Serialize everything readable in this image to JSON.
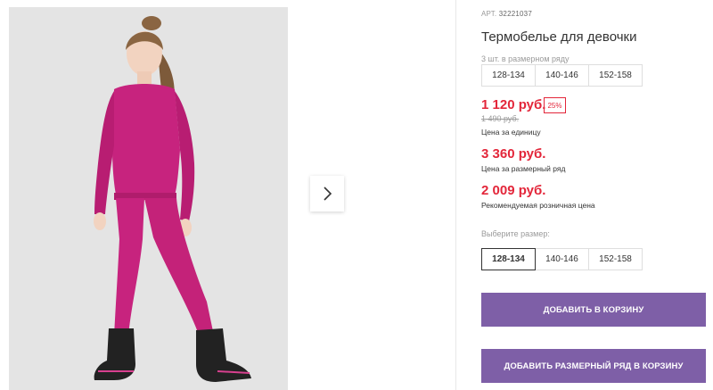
{
  "product": {
    "article_label": "АРТ.",
    "article_code": "32221037",
    "title": "Термобелье для девочки",
    "size_row_label": "3 шт. в размерном ряду",
    "size_row": [
      "128-134",
      "140-146",
      "152-158"
    ],
    "price_unit": "1 120 руб.",
    "discount_badge": "25%",
    "old_price": "1 490 руб.",
    "price_unit_note": "Цена за единицу",
    "price_row": "3 360 руб.",
    "price_row_note": "Цена за размерный ряд",
    "price_retail": "2 009 руб.",
    "price_retail_note": "Рекомендуемая розничная цена",
    "choose_size_label": "Выберите размер:",
    "sizes": [
      "128-134",
      "140-146",
      "152-158"
    ],
    "selected_size": "128-134",
    "add_to_cart_label": "ДОБАВИТЬ В КОРЗИНУ",
    "add_row_to_cart_label": "ДОБАВИТЬ РАЗМЕРНЫЙ РЯД В КОРЗИНУ"
  },
  "gallery": {
    "next_icon": "chevron-right-icon"
  },
  "colors": {
    "accent": "#7e5fa7",
    "price": "#e3263a",
    "garment": "#c7237e"
  }
}
